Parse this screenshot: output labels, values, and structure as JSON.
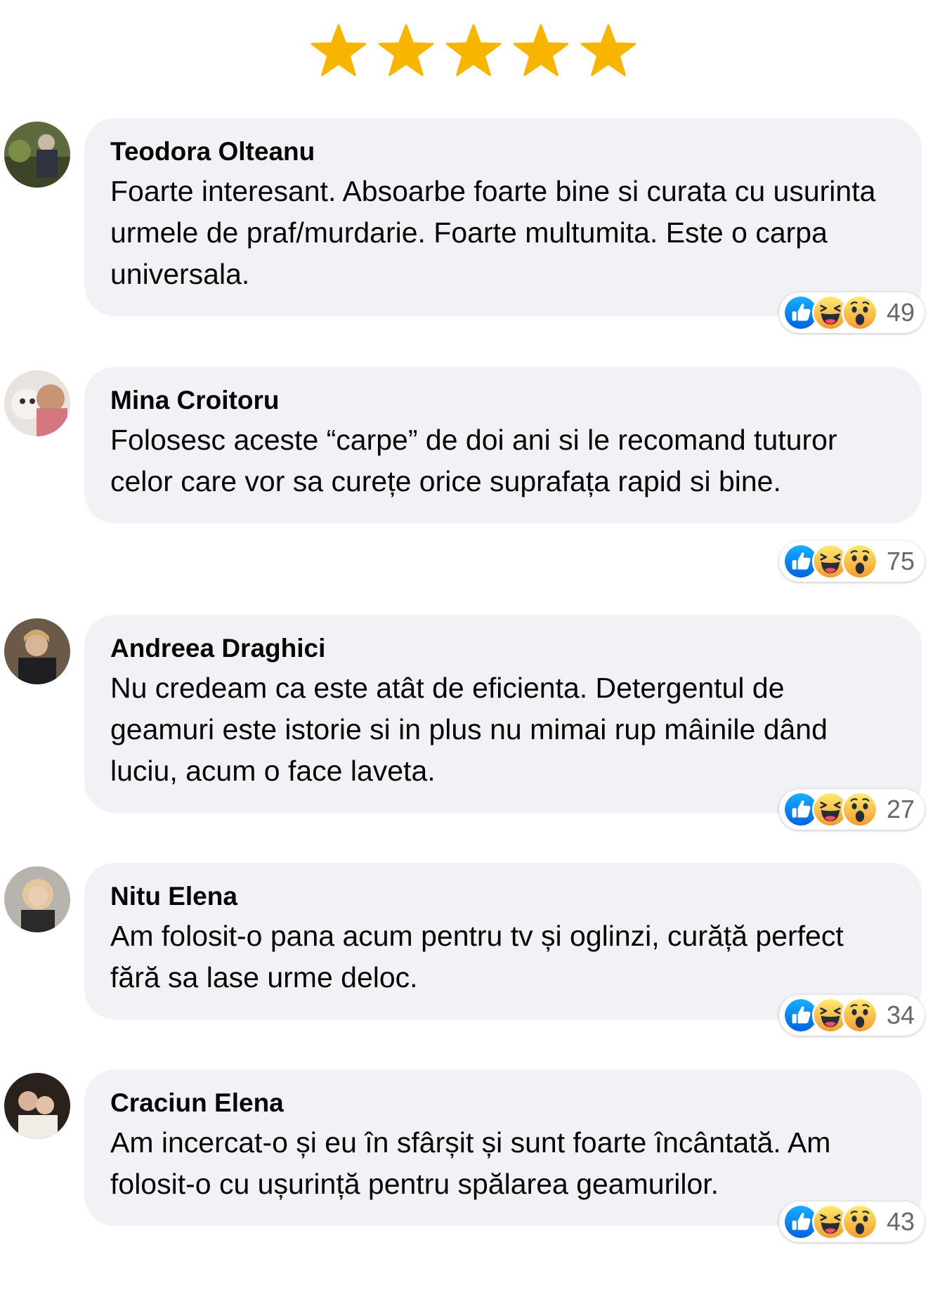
{
  "rating": {
    "stars": 5,
    "max": 5,
    "color": "#F7B500"
  },
  "reaction_icons": [
    "like-icon",
    "haha-icon",
    "wow-icon"
  ],
  "comments": [
    {
      "author": "Teodora Olteanu",
      "text": "Foarte interesant. Absoarbe foarte bine si curata cu usurinta urmele de praf/murdarie. Foarte multumita. Este o carpa universala.",
      "reaction_count": "49"
    },
    {
      "author": "Mina Croitoru",
      "text": "Folosesc aceste “carpe” de doi ani si le recomand tuturor celor care vor sa curețe orice suprafața rapid si bine.",
      "reaction_count": "75"
    },
    {
      "author": "Andreea Draghici",
      "text": "Nu credeam ca este atât de eficienta. Detergentul de geamuri este istorie si in plus nu mimai rup mâinile dând luciu, acum o face laveta.",
      "reaction_count": "27"
    },
    {
      "author": "Nitu Elena",
      "text": "Am folosit-o pana acum pentru tv și oglinzi, curăță perfect fără sa lase urme deloc.",
      "reaction_count": "34"
    },
    {
      "author": "Craciun Elena",
      "text": "Am incercat-o și eu în sfârșit și sunt foarte încântată. Am folosit-o cu ușurință pentru spălarea geamurilor.",
      "reaction_count": "43"
    }
  ]
}
